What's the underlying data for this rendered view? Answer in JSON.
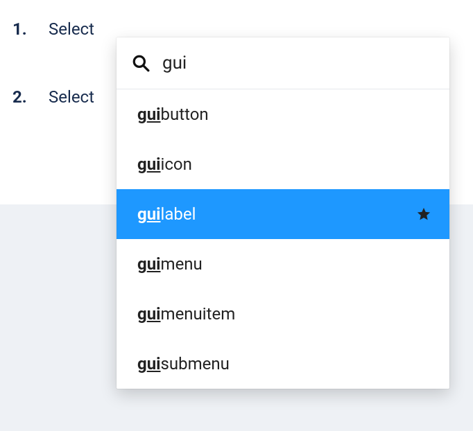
{
  "steps": [
    {
      "number": "1.",
      "text": "Select"
    },
    {
      "number": "2.",
      "text": "Select"
    }
  ],
  "search": {
    "query": "gui",
    "placeholder": ""
  },
  "results": [
    {
      "prefix": "g",
      "underlined": "ui",
      "suffix": "button",
      "selected": false,
      "starred": false
    },
    {
      "prefix": "g",
      "underlined": "ui",
      "suffix": "icon",
      "selected": false,
      "starred": false
    },
    {
      "prefix": "g",
      "underlined": "ui",
      "suffix": "label",
      "selected": true,
      "starred": true
    },
    {
      "prefix": "g",
      "underlined": "ui",
      "suffix": "menu",
      "selected": false,
      "starred": false
    },
    {
      "prefix": "g",
      "underlined": "ui",
      "suffix": "menuitem",
      "selected": false,
      "starred": false
    },
    {
      "prefix": "g",
      "underlined": "ui",
      "suffix": "submenu",
      "selected": false,
      "starred": false
    }
  ],
  "colors": {
    "selected_bg": "#1e98ff",
    "page_lower_bg": "#eef1f5",
    "text": "#172b4d"
  }
}
